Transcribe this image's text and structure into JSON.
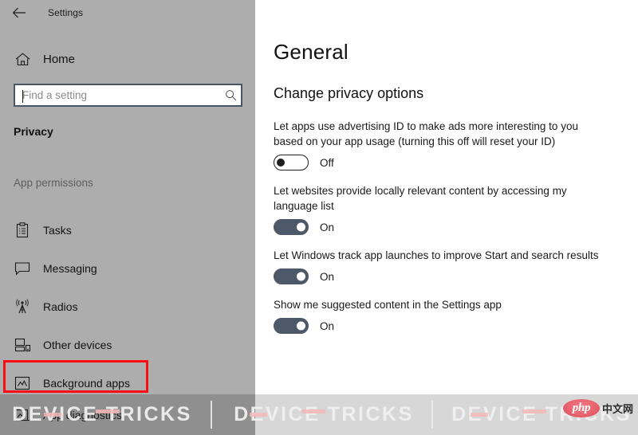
{
  "window": {
    "back_icon": "back-arrow-icon",
    "title": "Settings"
  },
  "sidebar": {
    "home": {
      "label": "Home",
      "icon": "home-icon"
    },
    "search": {
      "value": "",
      "placeholder": "Find a setting",
      "icon": "search-icon"
    },
    "section_title": "Privacy",
    "group_label": "App permissions",
    "items": [
      {
        "label": "Tasks",
        "icon": "clipboard-tasks-icon",
        "highlighted": false
      },
      {
        "label": "Messaging",
        "icon": "speech-bubble-icon",
        "highlighted": false
      },
      {
        "label": "Radios",
        "icon": "radio-tower-icon",
        "highlighted": false
      },
      {
        "label": "Other devices",
        "icon": "other-devices-icon",
        "highlighted": false
      },
      {
        "label": "Background apps",
        "icon": "background-apps-icon",
        "highlighted": true
      },
      {
        "label": "App diagnostics",
        "icon": "app-diagnostics-icon",
        "highlighted": false
      }
    ],
    "highlight_color": "#fc0d13"
  },
  "main": {
    "page_title": "General",
    "subtitle": "Change privacy options",
    "settings": [
      {
        "description": "Let apps use advertising ID to make ads more interesting to you based on your app usage (turning this off will reset your ID)",
        "state": "Off",
        "on": false
      },
      {
        "description": "Let websites provide locally relevant content by accessing my language list",
        "state": "On",
        "on": true
      },
      {
        "description": "Let Windows track app launches to improve Start and search results",
        "state": "On",
        "on": true
      },
      {
        "description": "Show me suggested content in the Settings app",
        "state": "On",
        "on": true
      }
    ],
    "toggle_on_color": "#4d5869"
  },
  "watermark": {
    "text": "DEVICE TRICKS",
    "repeats": 3,
    "logo": {
      "name": "php",
      "suffix": "中文网",
      "color": "#e8636f"
    }
  }
}
